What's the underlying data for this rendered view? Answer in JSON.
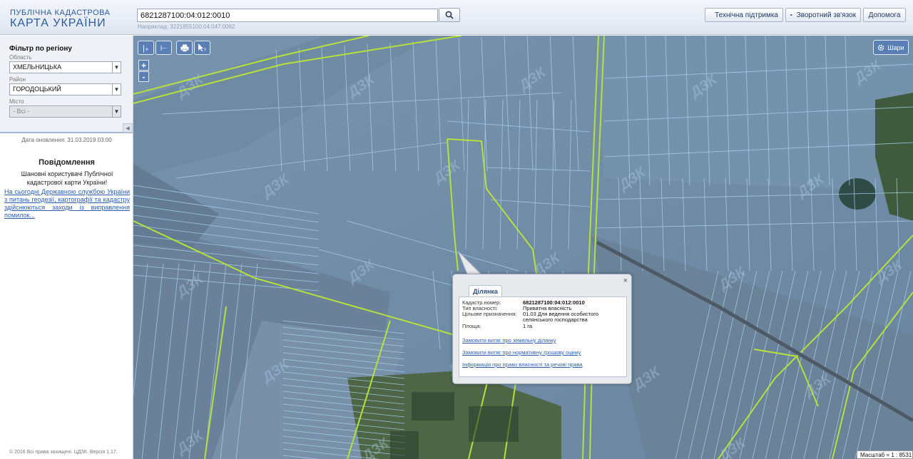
{
  "header": {
    "logo_line1": "ПУБЛІЧНА КАДАСТРОВА",
    "logo_line2": "КАРТА УКРАЇНИ",
    "search_value": "6821287100:04:012:0010",
    "search_hint": "Наприклад: 3221855100:04:047:0062",
    "buttons": {
      "support": "Технічна підтримка",
      "feedback": "Зворотний зв'язок",
      "help": "Допомога"
    }
  },
  "sidebar": {
    "filter_title": "Фільтр по регіону",
    "region_label": "Область",
    "region_value": "ХМЕЛЬНИЦЬКА",
    "district_label": "Район",
    "district_value": "ГОРОДОЦЬКИЙ",
    "city_label": "Місто",
    "city_value": "- Всі -",
    "update_date": "Дата оновлення: 31.03.2019 03:00",
    "notice_title": "Повідомлення",
    "notice_body": "Шановні користувачі Публічної кадастрової карти України!",
    "notice_link": "На сьогодні Державною службою України з питань геодезії, картографії та кадастру здійснюються заходи із виправлення помилок...",
    "copyright": "© 2016 Всі права захищені. ЦДЗК. Версія 1.17."
  },
  "map": {
    "layers_label": "Шари",
    "zoom_in": "+",
    "zoom_out": "-",
    "scale": "Масштаб = 1 : 8531",
    "watermark": "ДЗК"
  },
  "popup": {
    "tab": "Ділянка",
    "close": "×",
    "fields": [
      {
        "label": "Кадастр.номер:",
        "value": "6821287100:04:012:0010"
      },
      {
        "label": "Тип власності:",
        "value": "Приватна власність"
      },
      {
        "label": "Цільове призначення:",
        "value": "01.03 Для ведення особистого селянського господарства"
      },
      {
        "label": "Площа:",
        "value": "1 га"
      }
    ],
    "links": [
      "Замовити витяг про земельну ділянку",
      "Замовити витяг про нормативну грошову оцінку",
      "Інформація про право власності та речові права"
    ]
  },
  "colors": {
    "parcel_line": "#a8d4f0",
    "boundary_line": "#b6e03a",
    "accent": "#2c5aa0"
  }
}
